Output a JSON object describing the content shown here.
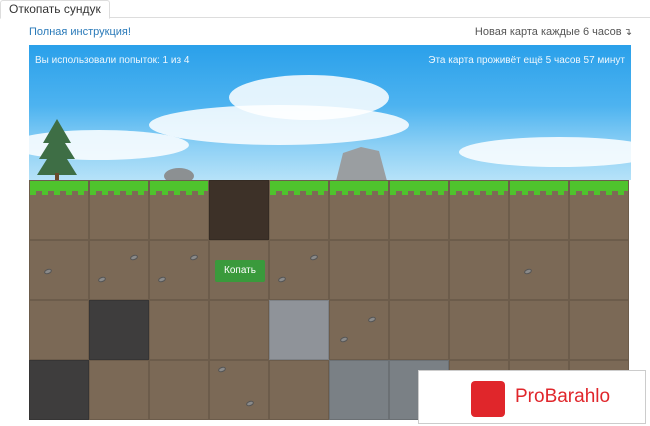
{
  "tabs": [
    {
      "label": "Откопать сундук"
    }
  ],
  "header": {
    "instructions_link": "Полная инструкция!",
    "new_map_text": "Новая карта каждые 6 часов",
    "new_map_arrow": "↴"
  },
  "hud": {
    "attempts": "Вы использовали попыток: 1 из 4",
    "map_lifetime": "Эта карта проживёт ещё 5 часов 57 минут"
  },
  "dig_button": {
    "label": "Копать"
  },
  "watermark": {
    "text": "ProBarahlo"
  },
  "colors": {
    "sky": "#2aa0ea",
    "grass": "#4fc32d",
    "dirt": "#7b6956",
    "button": "#3a9a3c",
    "link": "#2a7ab9",
    "watermark": "#e0262b"
  }
}
